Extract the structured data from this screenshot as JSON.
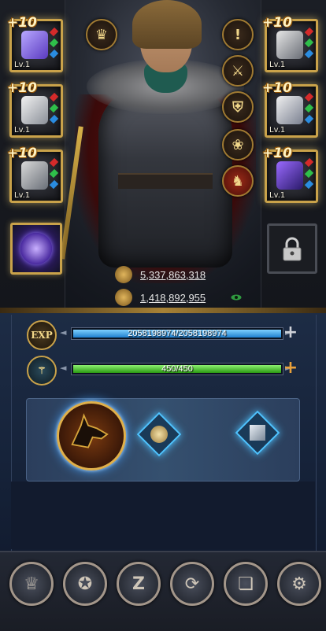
{
  "equipment": {
    "left": [
      {
        "enhance": "+10",
        "level": "Lv.1",
        "item_icon": "purple-gauntlet-icon"
      },
      {
        "enhance": "+10",
        "level": "Lv.1",
        "item_icon": "white-chestplate-icon"
      },
      {
        "enhance": "+10",
        "level": "Lv.1",
        "item_icon": "boots-icon"
      }
    ],
    "right": [
      {
        "enhance": "+10",
        "level": "Lv.1",
        "item_icon": "helmet-icon"
      },
      {
        "enhance": "+10",
        "level": "Lv.1",
        "item_icon": "chest-armor-icon"
      },
      {
        "enhance": "+10",
        "level": "Lv.1",
        "item_icon": "purple-shield-icon"
      }
    ]
  },
  "stats": {
    "power": "5,337,863,318",
    "might": "1,418,892,955"
  },
  "bars": {
    "exp": {
      "label": "EXP",
      "value": "2058198974/2058198974",
      "fill": 1.0
    },
    "stamina": {
      "value": "450/450",
      "fill": 1.0
    }
  },
  "colors": {
    "gold": "#c9a24a",
    "exp_bar": "#3ea8e8",
    "stamina_bar": "#35c020"
  }
}
